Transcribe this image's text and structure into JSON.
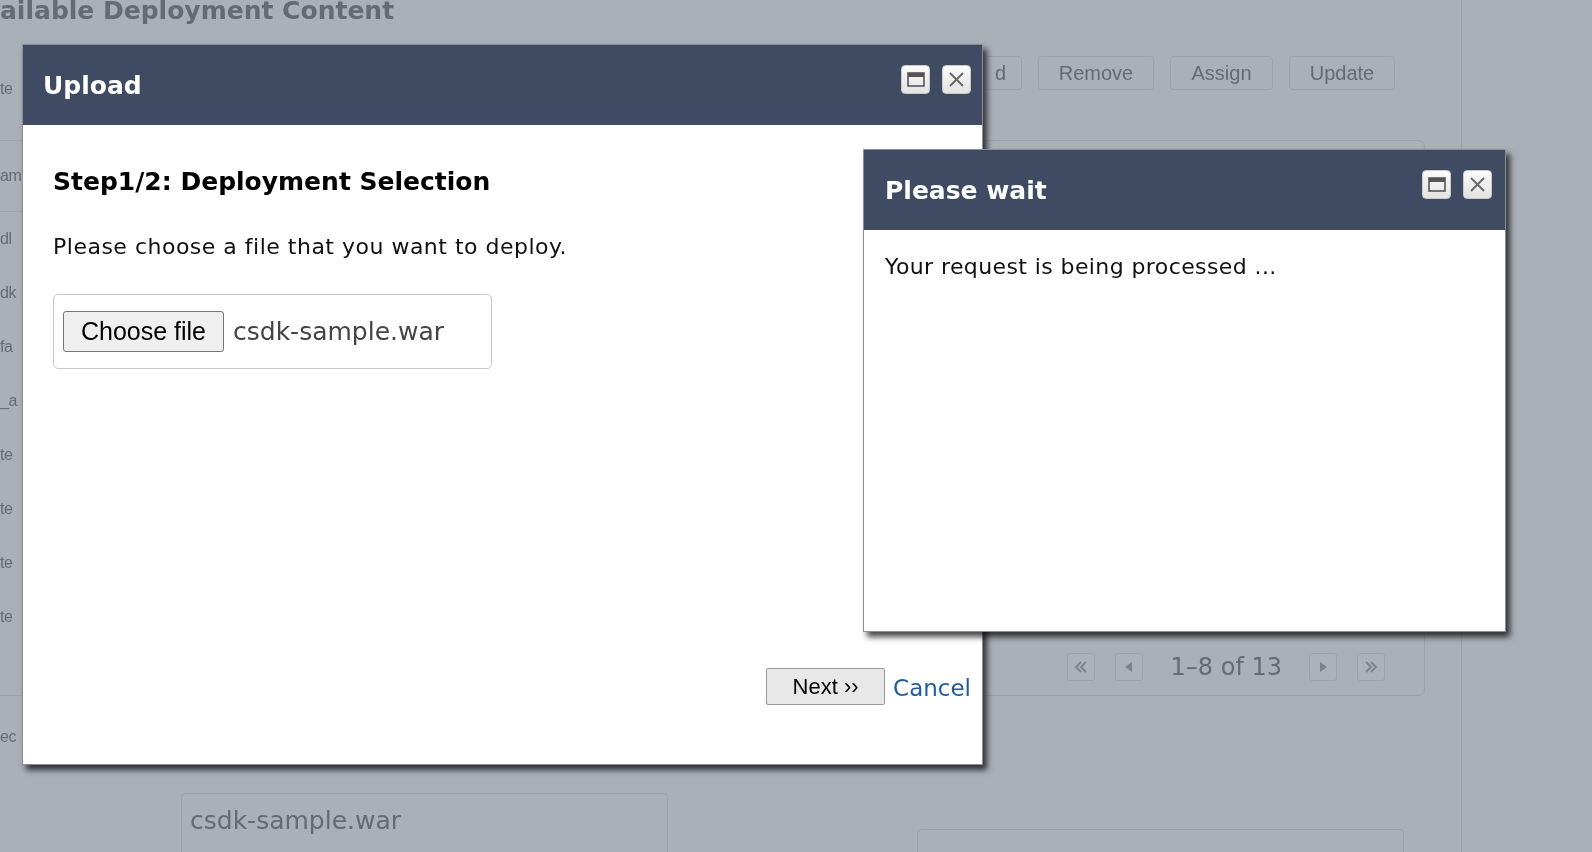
{
  "background_page": {
    "heading": "ailable Deployment Content",
    "filter_label": "te",
    "toolbar_buttons": [
      "d",
      "Remove",
      "Assign",
      "Update"
    ],
    "table": {
      "column_1_header": "am",
      "rows": [
        "dl",
        "dk",
        "fa",
        "_a",
        "te",
        "te",
        "te",
        "te"
      ]
    },
    "pagination": {
      "range": "1–8 of 13"
    },
    "section_label": "ec",
    "file_field": {
      "value": "csdk-sample.war"
    }
  },
  "upload_dialog": {
    "title": "Upload",
    "step_heading": "Step1/2: Deployment Selection",
    "instruction": "Please choose a file that you want to deploy.",
    "file_input": {
      "button_label": "Choose file",
      "file_name": "csdk-sample.war"
    },
    "actions": [
      {
        "kind": "button",
        "label": "Next ››"
      },
      {
        "kind": "link",
        "label": "Cancel"
      }
    ]
  },
  "wait_dialog": {
    "title": "Please wait",
    "message": "Your request is being processed ..."
  }
}
